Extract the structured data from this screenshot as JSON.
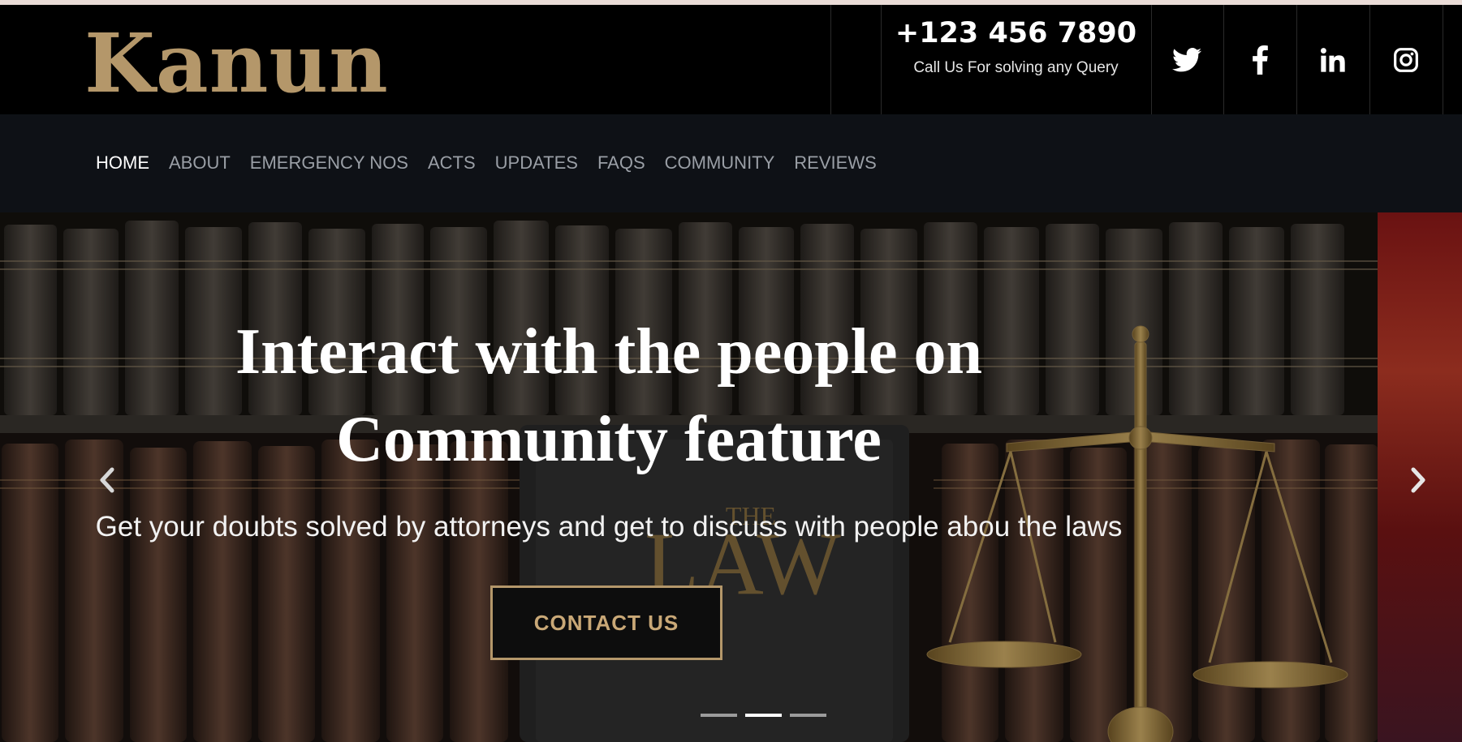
{
  "brand": {
    "logo_text": "Kanun",
    "accent_color": "#b4976a"
  },
  "contact": {
    "phone": "+123 456 7890",
    "subtext": "Call Us For solving any Query"
  },
  "social": [
    {
      "name": "twitter-icon"
    },
    {
      "name": "facebook-icon"
    },
    {
      "name": "linkedin-icon"
    },
    {
      "name": "instagram-icon"
    }
  ],
  "nav": {
    "items": [
      {
        "label": "HOME",
        "active": true
      },
      {
        "label": "ABOUT",
        "active": false
      },
      {
        "label": "EMERGENCY NOS",
        "active": false
      },
      {
        "label": "ACTS",
        "active": false
      },
      {
        "label": "UPDATES",
        "active": false
      },
      {
        "label": "FAQS",
        "active": false
      },
      {
        "label": "COMMUNITY",
        "active": false
      },
      {
        "label": "REVIEWS",
        "active": false
      }
    ]
  },
  "hero": {
    "title_line1": "Interact with the people on",
    "title_line2": "Community feature",
    "subtitle": "Get your doubts solved by attorneys and get to discuss with people abou the laws",
    "cta_label": "CONTACT US",
    "book_title_small": "THE",
    "book_title_large": "LAW",
    "slide_count": 3,
    "active_slide": 2,
    "prev_icon": "chevron-left-icon",
    "next_icon": "chevron-right-icon"
  }
}
